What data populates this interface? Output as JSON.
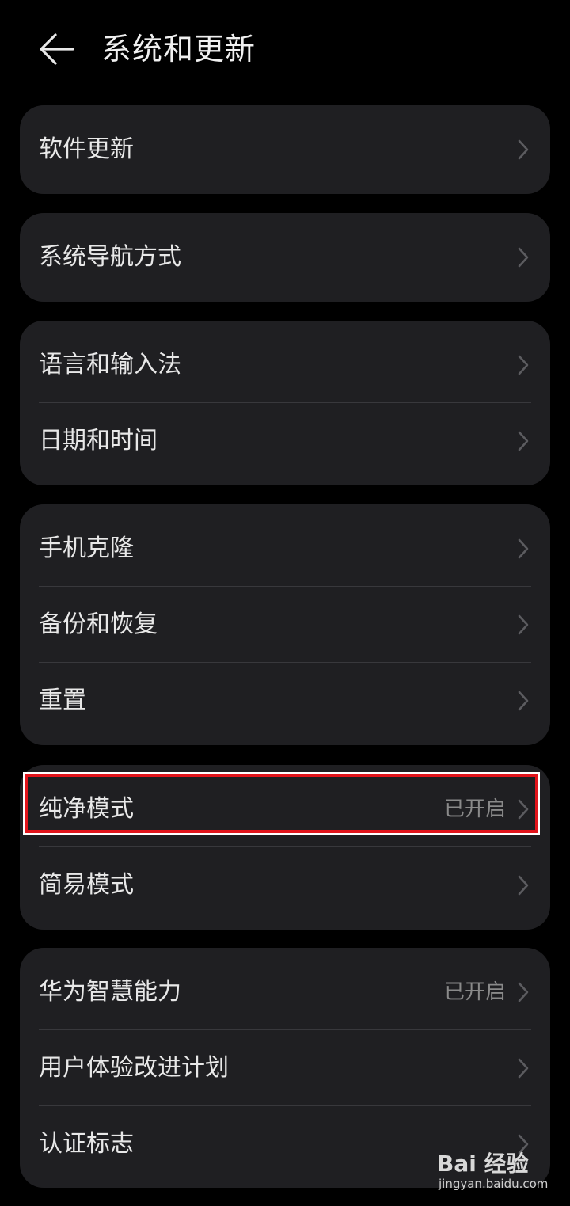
{
  "header": {
    "title": "系统和更新",
    "back_icon": "arrow-left-icon"
  },
  "groups": [
    {
      "items": [
        {
          "label": "软件更新"
        }
      ]
    },
    {
      "items": [
        {
          "label": "系统导航方式"
        }
      ]
    },
    {
      "items": [
        {
          "label": "语言和输入法"
        },
        {
          "label": "日期和时间"
        }
      ]
    },
    {
      "items": [
        {
          "label": "手机克隆"
        },
        {
          "label": "备份和恢复"
        },
        {
          "label": "重置"
        }
      ]
    },
    {
      "items": [
        {
          "label": "纯净模式",
          "value": "已开启"
        },
        {
          "label": "简易模式"
        }
      ]
    },
    {
      "items": [
        {
          "label": "华为智慧能力",
          "value": "已开启"
        },
        {
          "label": "用户体验改进计划"
        },
        {
          "label": "认证标志"
        }
      ]
    }
  ],
  "watermark": {
    "logo": "Bai 经验",
    "url": "jingyan.baidu.com"
  },
  "colors": {
    "background": "#000000",
    "card": "#1f1f22",
    "highlight": "#e1141b",
    "secondary_text": "#8a8a8a"
  }
}
